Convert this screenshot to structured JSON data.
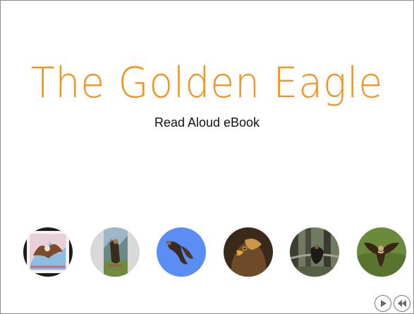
{
  "book": {
    "title": "The Golden Eagle",
    "subtitle": "Read Aloud eBook"
  },
  "thumbnails": [
    {
      "label": "stamp-eagle-thumbnail",
      "dominant_color": "#d9a9b6"
    },
    {
      "label": "perched-eagle-thumbnail",
      "dominant_color": "#d8d8d8"
    },
    {
      "label": "soaring-eagle-thumbnail",
      "dominant_color": "#5a8ef5"
    },
    {
      "label": "eagle-portrait-thumbnail",
      "dominant_color": "#6f4a2a"
    },
    {
      "label": "forest-eagle-thumbnail",
      "dominant_color": "#5b6a4a"
    },
    {
      "label": "flying-eagle-green-thumbnail",
      "dominant_color": "#6b8a3c"
    }
  ],
  "controls": {
    "play_icon": "play-icon",
    "rewind_icon": "rewind-icon"
  },
  "colors": {
    "title": "#f29322",
    "subtitle": "#111111",
    "border": "#8a8a8a"
  }
}
